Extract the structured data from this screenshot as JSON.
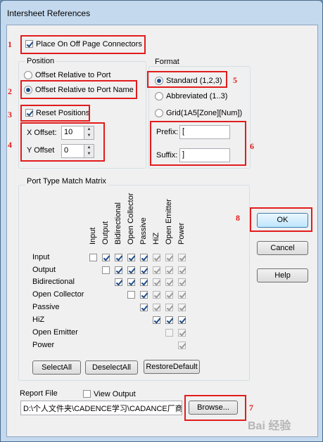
{
  "window": {
    "title": "Intersheet References"
  },
  "connectors": {
    "label": "Place On Off Page Connectors",
    "checked": true
  },
  "position": {
    "group_label": "Position",
    "option_port": "Offset Relative to Port",
    "option_port_name": "Offset Relative to Port Name",
    "selected": "option_port_name",
    "reset_label": "Reset Positions",
    "reset_checked": true,
    "x_label": "X Offset:",
    "x_value": "10",
    "y_label": "Y Offset",
    "y_value": "0"
  },
  "format": {
    "group_label": "Format",
    "standard": "Standard (1,2,3)",
    "abbreviated": "Abbreviated (1..3)",
    "grid": "Grid(1A5[Zone][Num])",
    "selected": "standard",
    "prefix_label": "Prefix:",
    "prefix_value": "[",
    "suffix_label": "Suffix:",
    "suffix_value": "]"
  },
  "matrix": {
    "group_label": "Port Type Match Matrix",
    "columns": [
      "Input",
      "Output",
      "Bidirectional",
      "Open Collector",
      "Passive",
      "HiZ",
      "Open Emitter",
      "Power"
    ],
    "rows": [
      "Input",
      "Output",
      "Bidirectional",
      "Open Collector",
      "Passive",
      "HiZ",
      "Open Emitter",
      "Power"
    ],
    "select_all": "SelectAll",
    "deselect_all": "DeselectAll",
    "restore_default": "RestoreDefault"
  },
  "buttons": {
    "ok": "OK",
    "cancel": "Cancel",
    "help": "Help",
    "browse": "Browse..."
  },
  "report": {
    "label": "Report File",
    "view_output_label": "View Output",
    "view_output_checked": false,
    "path": "D:\\个人文件夹\\CADENCE学习\\CADANCE厂商"
  },
  "annotations": {
    "n1": "1",
    "n2": "2",
    "n3": "3",
    "n4": "4",
    "n5": "5",
    "n6": "6",
    "n7": "7",
    "n8": "8"
  },
  "watermark": "Bai 经验"
}
